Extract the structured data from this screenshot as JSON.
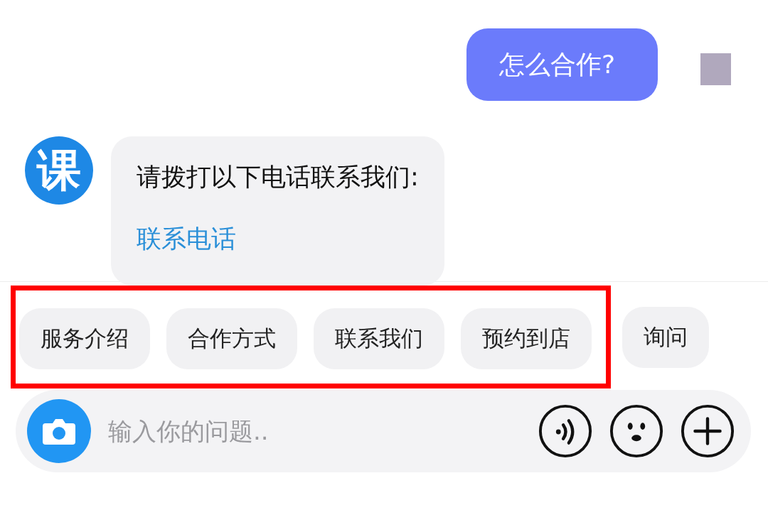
{
  "messages": [
    {
      "kind": "user",
      "text": "怎么合作?"
    },
    {
      "kind": "bot",
      "avatar": "课",
      "text": "请拨打以下电话联系我们:",
      "link": "联系电话"
    }
  ],
  "quick_replies": [
    {
      "label": "服务介绍",
      "highlighted": true
    },
    {
      "label": "合作方式",
      "highlighted": true
    },
    {
      "label": "联系我们",
      "highlighted": true
    },
    {
      "label": "预约到店",
      "highlighted": true
    },
    {
      "label": "询问",
      "highlighted": false
    }
  ],
  "input": {
    "placeholder": "输入你的问题.."
  }
}
